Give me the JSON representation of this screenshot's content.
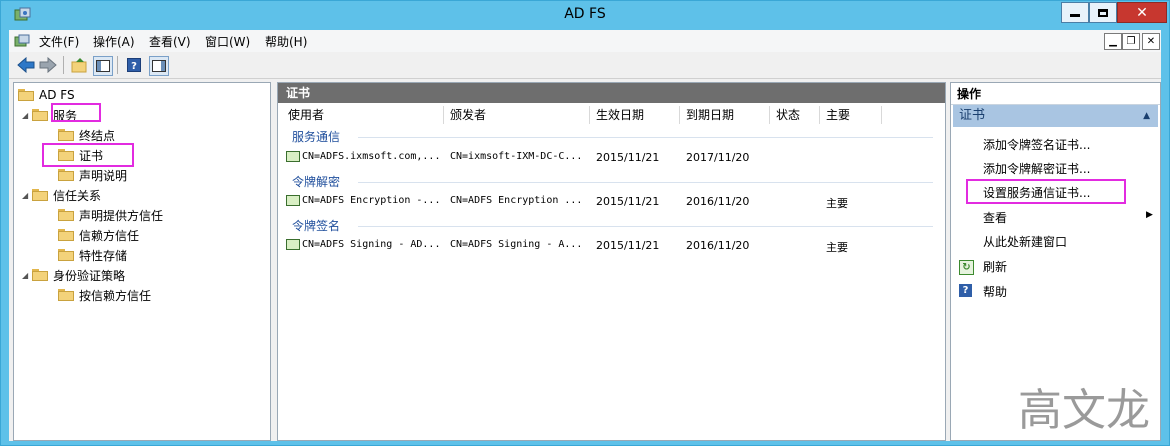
{
  "window": {
    "title": "AD FS"
  },
  "menu": [
    "文件(F)",
    "操作(A)",
    "查看(V)",
    "窗口(W)",
    "帮助(H)"
  ],
  "tree": {
    "root": "AD FS",
    "services": "服务",
    "endpoints": "终结点",
    "certificates": "证书",
    "claim_descriptions": "声明说明",
    "trust_relationships": "信任关系",
    "claims_provider_trusts": "声明提供方信任",
    "relying_party_trusts": "信赖方信任",
    "attribute_stores": "特性存储",
    "auth_policies": "身份验证策略",
    "per_relying_party_trust": "按信赖方信任"
  },
  "center": {
    "title": "证书",
    "columns": [
      "使用者",
      "颁发者",
      "生效日期",
      "到期日期",
      "状态",
      "主要"
    ],
    "groups": [
      {
        "name": "服务通信",
        "row": {
          "subject": "CN=ADFS.ixmsoft.com,...",
          "issuer": "CN=ixmsoft-IXM-DC-C...",
          "effective": "2015/11/21",
          "expiry": "2017/11/20",
          "status": "",
          "primary": ""
        }
      },
      {
        "name": "令牌解密",
        "row": {
          "subject": "CN=ADFS Encryption -...",
          "issuer": "CN=ADFS Encryption ...",
          "effective": "2015/11/21",
          "expiry": "2016/11/20",
          "status": "",
          "primary": "主要"
        }
      },
      {
        "name": "令牌签名",
        "row": {
          "subject": "CN=ADFS Signing - AD...",
          "issuer": "CN=ADFS Signing - A...",
          "effective": "2015/11/21",
          "expiry": "2016/11/20",
          "status": "",
          "primary": "主要"
        }
      }
    ]
  },
  "actions": {
    "title": "操作",
    "section": "证书",
    "items": [
      "添加令牌签名证书...",
      "添加令牌解密证书...",
      "设置服务通信证书...",
      "查看",
      "从此处新建窗口",
      "刷新",
      "帮助"
    ]
  },
  "watermark": "高文龙",
  "colors": {
    "title_bar": "#5ec1e9",
    "highlight": "#e22be0",
    "pane_header": "#6e6e6e",
    "action_section": "#a9c5e2"
  }
}
